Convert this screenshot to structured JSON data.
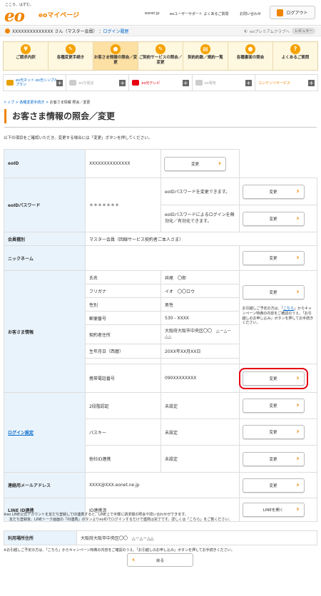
{
  "header": {
    "tagline": "こころ、はずむ。",
    "logo": "eo",
    "logo_sub": "eoマイページ",
    "links": [
      "eonet.jp",
      "eoユーザーサポート よくあるご質問",
      "お問い合わせ"
    ],
    "logout_label": "ログアウト"
  },
  "userbar": {
    "user_name": "XXXXXXXXXXXXXX さん（マスター会員）",
    "login_history": "ログイン履歴",
    "premium": "eoプレミアムクラブへ",
    "level": "レギュラー"
  },
  "menu": [
    {
      "icon": "¥",
      "label": "ご請求内訳"
    },
    {
      "icon": "✎",
      "label": "各種変更手続き"
    },
    {
      "icon": "●",
      "label": "お客さま情報の照会／変更"
    },
    {
      "icon": "✎",
      "label": "ご契約サービスの照会／変更"
    },
    {
      "icon": "▤",
      "label": "契約約款／規約一覧"
    },
    {
      "icon": "●",
      "label": "各種書面の照会"
    },
    {
      "icon": "?",
      "label": "よくあるご質問"
    }
  ],
  "services": [
    {
      "label": "eo光ネット eo光シンプルプラン",
      "color": "#e6a100",
      "muted": false
    },
    {
      "label": "eo光電話",
      "color": "#ccc",
      "muted": true
    },
    {
      "label": "eo光テレビ",
      "color": "#e60012",
      "muted": false
    },
    {
      "label": "eo電気",
      "color": "#ccc",
      "muted": true
    },
    {
      "label": "コンテンツサービス",
      "color": "#fff",
      "muted": false
    }
  ],
  "breadcrumb": [
    "トップ",
    "各種変更手続き",
    "お客さま情報 照会／変更"
  ],
  "page_title": "お客さま情報の照会／変更",
  "intro": "以下の項目をご確認いただき、変更する場合には「変更」ボタンを押してください。",
  "change_label": "変更",
  "rows": {
    "eoid": {
      "label": "eoID",
      "value": "XXXXXXXXXXXXXX"
    },
    "password": {
      "label": "eoIDパスワード",
      "value": "＊＊＊＊＊＊＊",
      "desc1": "eoIDパスワードを変更できます。",
      "desc2": "eoIDパスワードによるログインを無効化／有効化できます。"
    },
    "member": {
      "label": "会員種別",
      "value": "マスター会員（回線サービス契約者ご本人さま）"
    },
    "nickname": {
      "label": "ニックネーム",
      "value": ""
    },
    "customer": {
      "label": "お客さま情報",
      "fields": [
        {
          "k": "氏名",
          "v": "井尾　〇郎"
        },
        {
          "k": "フリガナ",
          "v": "イオ　〇〇ロウ"
        },
        {
          "k": "性別",
          "v": "男性"
        },
        {
          "k": "郵便番号",
          "v": "530 - XXXX"
        },
        {
          "k": "契約者住所",
          "v": "大阪府大阪市中央区〇〇　△－△－△△"
        },
        {
          "k": "生年月日（西暦）",
          "v": "20XX年XX月XX日"
        }
      ],
      "phone_label": "携帯電話番号",
      "phone_value": "090XXXXXXXX",
      "note_pre": "お引越しご予定の方は、「",
      "note_link": "こちら",
      "note_post": "」からキャンペーン特典の内容をご確認のうえ、「お引越しのお申し込み」ボタンを押してお手続きください。"
    },
    "login": {
      "label": "ログイン設定",
      "items": [
        {
          "k": "2段階認証",
          "v": "未設定"
        },
        {
          "k": "パスキー",
          "v": "未設定"
        },
        {
          "k": "他社ID連携",
          "v": "未設定"
        }
      ]
    },
    "email": {
      "label": "連絡用メールアドレス",
      "value": "XXXX@XXX.eonet.ne.jp"
    },
    "line": {
      "label": "LINE ID連携",
      "value": "ID連携済",
      "button": "LINEを開く"
    }
  },
  "line_note_1": "※eo LINE公式アカウントを友だち登録してID連携すると、LINE上で手軽に請求額の照会や問い合わせができます。",
  "line_note_2": "友だち登録後、LINEトーク画面の「ID連携」ボタンよりeoIDでログインするだけで連携は完了です。詳しくは「こちら」をご覧ください。",
  "usage": {
    "label": "利用場所住所",
    "value": "大阪府大阪市中央区〇〇　△－△－△△"
  },
  "bottom_note": "※お引越しご予定の方は、「こちら」からキャンペーン特典の内容をご確認のうえ、「お引越しのお申し込み」ボタンを押してお手続きください。",
  "back_label": "戻る"
}
